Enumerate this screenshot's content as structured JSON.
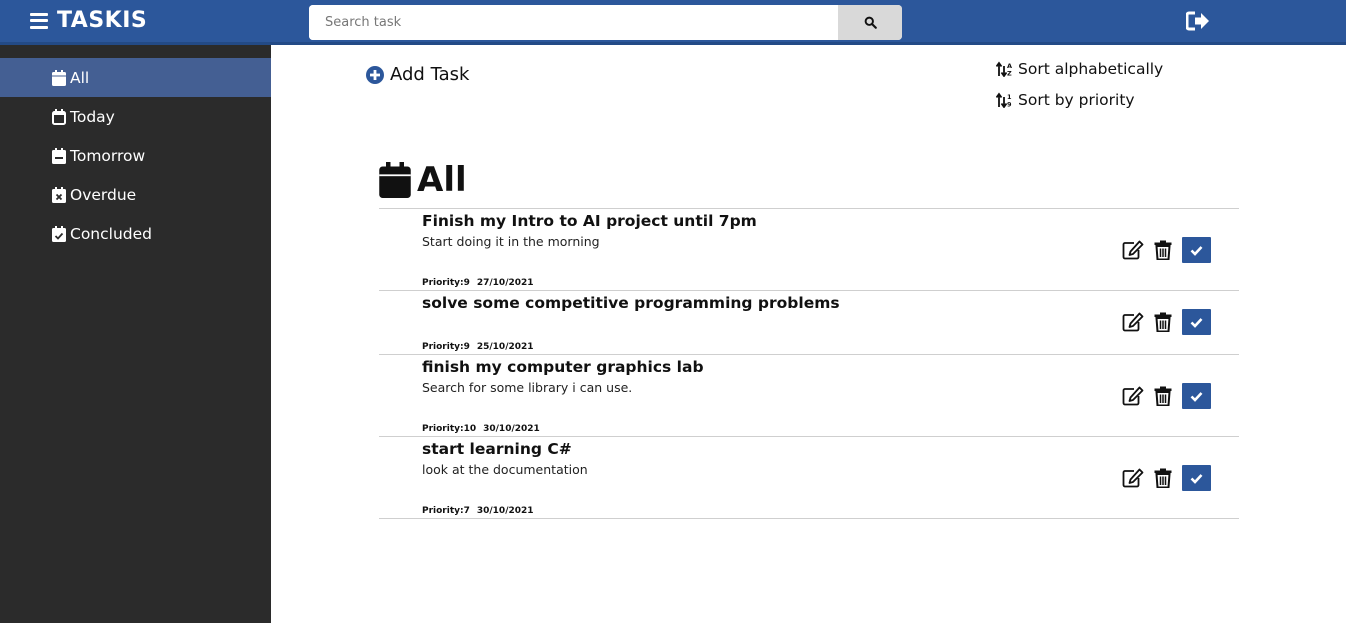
{
  "app": {
    "title": "TASKIS"
  },
  "search": {
    "placeholder": "Search task"
  },
  "sidebar": {
    "items": [
      {
        "label": "All",
        "icon": "calendar-icon",
        "active": true
      },
      {
        "label": "Today",
        "icon": "calendar-blank-icon",
        "active": false
      },
      {
        "label": "Tomorrow",
        "icon": "calendar-minus-icon",
        "active": false
      },
      {
        "label": "Overdue",
        "icon": "calendar-x-icon",
        "active": false
      },
      {
        "label": "Concluded",
        "icon": "calendar-check-icon",
        "active": false
      }
    ]
  },
  "main": {
    "add_task_label": "Add Task",
    "sort_alpha_label": "Sort alphabetically",
    "sort_priority_label": "Sort by priority",
    "section_title": "All"
  },
  "tasks": [
    {
      "name": "Finish my Intro to AI project until 7pm",
      "description": "Start doing it in the morning",
      "priority": "Priority:9",
      "date": "27/10/2021"
    },
    {
      "name": "solve some competitive programming problems",
      "description": "",
      "priority": "Priority:9",
      "date": "25/10/2021"
    },
    {
      "name": "finish my computer graphics lab",
      "description": "Search for some library i can use.",
      "priority": "Priority:10",
      "date": "30/10/2021"
    },
    {
      "name": "start learning C#",
      "description": "look at the documentation",
      "priority": "Priority:7",
      "date": "30/10/2021"
    }
  ],
  "colors": {
    "accent": "#2c579b",
    "sidebar_bg": "#2b2b2b",
    "sidebar_active": "#445f93",
    "search_button": "#d9d9d9"
  }
}
